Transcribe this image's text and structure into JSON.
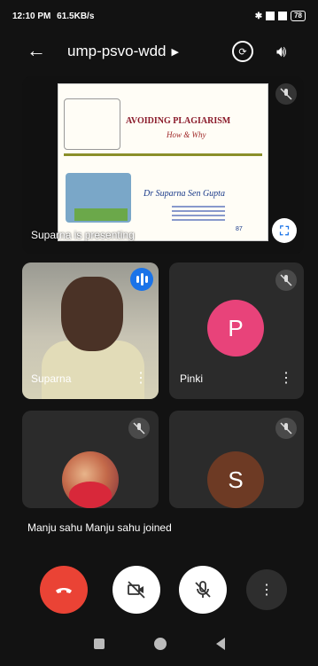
{
  "status_bar": {
    "time": "12:10 PM",
    "network_speed": "61.5KB/s",
    "battery": "78"
  },
  "header": {
    "meeting_code": "ump-psvo-wdd",
    "back_icon": "arrow-left-icon",
    "switch_camera_icon": "switch-camera-icon",
    "speaker_icon": "volume-icon"
  },
  "presentation": {
    "label": "Suparna is presenting",
    "slide": {
      "title": "AVOIDING PLAGIARISM",
      "subtitle": "How & Why",
      "author": "Dr Suparna Sen Gupta",
      "page": "87"
    }
  },
  "participants": [
    {
      "name": "Suparna",
      "video": true,
      "speaking": true
    },
    {
      "name": "Pinki",
      "initial": "P",
      "avatar_color": "#e8437a",
      "muted": true
    },
    {
      "name": "",
      "photo": true,
      "muted": true
    },
    {
      "name": "",
      "initial": "S",
      "avatar_color": "#6d3a24",
      "muted": true
    }
  ],
  "toast": "Manju sahu Manju sahu joined",
  "controls": {
    "end_call_icon": "end-call-icon",
    "camera_icon": "camera-off-icon",
    "mic_icon": "mic-off-icon",
    "more_icon": "more-vert-icon"
  },
  "colors": {
    "end_call": "#ea4335",
    "accent": "#1a73e8",
    "tile_bg": "#2b2b2b"
  }
}
